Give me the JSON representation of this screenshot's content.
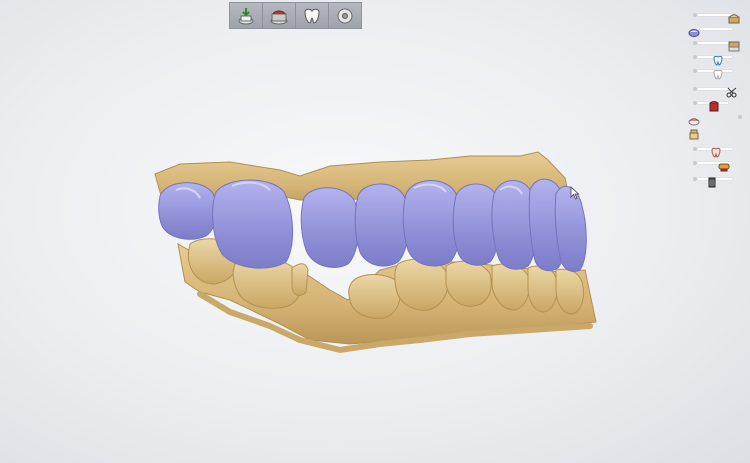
{
  "toolbar": {
    "buttons": [
      {
        "icon": "scan-download-icon"
      },
      {
        "icon": "model-base-icon"
      },
      {
        "icon": "tooth-crown-icon"
      },
      {
        "icon": "disc-export-icon"
      }
    ]
  },
  "visibility_panel": {
    "items": [
      {
        "icon": "upper-jaw-icon"
      },
      {
        "icon": "lower-jaw-icon"
      },
      {
        "icon": "antagonist-icon"
      },
      {
        "icon": "crown-design-icon"
      },
      {
        "icon": "crown-outline-icon"
      },
      {
        "icon": "scissors-icon"
      },
      {
        "icon": "die-red-icon"
      },
      {
        "icon": "gingiva-icon"
      },
      {
        "icon": "preparation-icon"
      },
      {
        "icon": "abutment-icon"
      },
      {
        "icon": "bridge-icon"
      },
      {
        "icon": "implant-icon"
      }
    ]
  },
  "viewport": {
    "upper_crown_color": "#8f8fd6",
    "model_color": "#d8b97c"
  }
}
